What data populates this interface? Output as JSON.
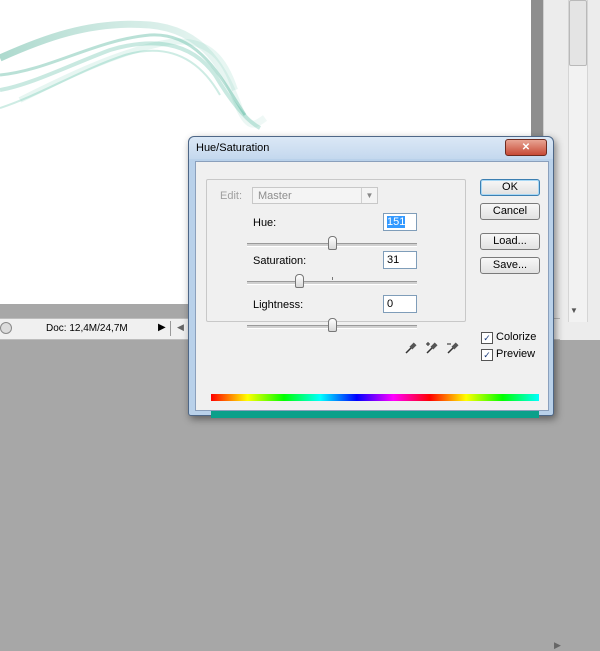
{
  "status_bar": {
    "doc_info": "Doc: 12,4M/24,7M"
  },
  "dialog": {
    "title": "Hue/Saturation",
    "edit_label": "Edit:",
    "edit_value": "Master",
    "hue": {
      "label": "Hue:",
      "value": "151",
      "fraction": 0.5
    },
    "saturation": {
      "label": "Saturation:",
      "value": "31",
      "fraction": 0.31
    },
    "lightness": {
      "label": "Lightness:",
      "value": "0",
      "fraction": 0.5
    },
    "buttons": {
      "ok": "OK",
      "cancel": "Cancel",
      "load": "Load...",
      "save": "Save..."
    },
    "colorize": {
      "label": "Colorize",
      "checked": true
    },
    "preview": {
      "label": "Preview",
      "checked": true
    },
    "result_color": "#0ca08a"
  },
  "icons": [
    "close-icon",
    "eyedropper-icon",
    "eyedropper-plus-icon",
    "eyedropper-minus-icon",
    "status-circle-icon",
    "arrow-right-icon"
  ]
}
